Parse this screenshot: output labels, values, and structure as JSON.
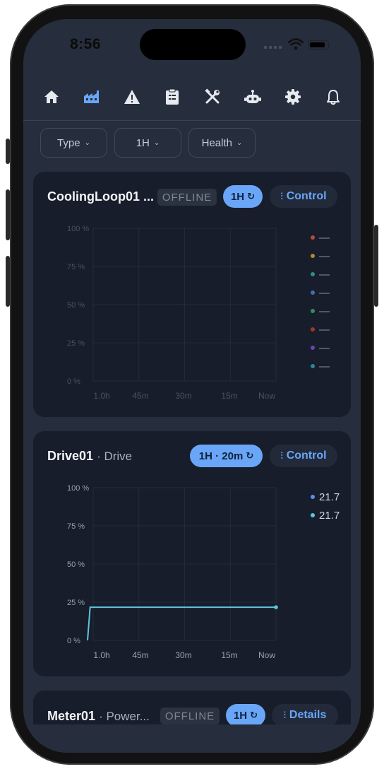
{
  "status_bar": {
    "time": "8:56"
  },
  "nav": {
    "items": [
      {
        "icon": "home-icon",
        "active": false
      },
      {
        "icon": "factory-icon",
        "active": true
      },
      {
        "icon": "warning-icon",
        "active": false
      },
      {
        "icon": "clipboard-icon",
        "active": false
      },
      {
        "icon": "tools-icon",
        "active": false
      },
      {
        "icon": "robot-icon",
        "active": false
      },
      {
        "icon": "gear-icon",
        "active": false
      },
      {
        "icon": "bell-icon",
        "active": false
      }
    ],
    "active_color": "#6aa6f8",
    "inactive_color": "#e6e9ee"
  },
  "filters": {
    "type_label": "Type",
    "range_label": "1H",
    "health_label": "Health"
  },
  "cards": [
    {
      "title": "CoolingLoop01 ...",
      "status": "OFFLINE",
      "range_pill": "1H",
      "action_label": "Control",
      "legend": [
        {
          "color": "#b5493f",
          "value": "—"
        },
        {
          "color": "#b8872e",
          "value": "—"
        },
        {
          "color": "#2f8d8a",
          "value": "—"
        },
        {
          "color": "#3f6fb3",
          "value": "—"
        },
        {
          "color": "#3b8a5c",
          "value": "—"
        },
        {
          "color": "#a2342f",
          "value": "—"
        },
        {
          "color": "#6a45b8",
          "value": "—"
        },
        {
          "color": "#2a8795",
          "value": "—"
        }
      ]
    },
    {
      "title": "Drive01",
      "subtitle": "· Drive",
      "range_pill": "1H · 20m",
      "action_label": "Control",
      "legend": [
        {
          "color": "#5b8ef0",
          "value": "21.7"
        },
        {
          "color": "#5fc3e0",
          "value": "21.7"
        }
      ]
    },
    {
      "title": "Meter01",
      "subtitle": "· Power...",
      "status": "OFFLINE",
      "range_pill": "1H",
      "action_label": "Details"
    }
  ],
  "chart_data": [
    {
      "type": "line",
      "title": "",
      "x": [
        "1.0h",
        "45m",
        "30m",
        "15m",
        "Now"
      ],
      "y_ticks": [
        "100 %",
        "75 %",
        "50 %",
        "25 %",
        "0 %"
      ],
      "ylim": [
        0,
        100
      ],
      "series": [],
      "grid": true,
      "legend_placement": "right"
    },
    {
      "type": "line",
      "title": "",
      "x": [
        "1.0h",
        "45m",
        "30m",
        "15m",
        "Now"
      ],
      "y_ticks": [
        "100 %",
        "75 %",
        "50 %",
        "25 %",
        "0 %"
      ],
      "ylim": [
        0,
        100
      ],
      "series": [
        {
          "color": "#5fc3e0",
          "points": [
            [
              -62,
              0
            ],
            [
              -61,
              21.7
            ],
            [
              0,
              21.7
            ]
          ]
        }
      ],
      "grid": true,
      "legend_placement": "right"
    }
  ]
}
